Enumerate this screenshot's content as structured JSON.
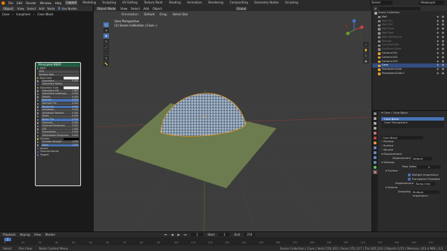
{
  "menu": {
    "items": [
      "File",
      "Edit",
      "Render",
      "Window",
      "Help"
    ],
    "workspaces": [
      "Layout",
      "Modeling",
      "Sculpting",
      "UV Editing",
      "Texture Paint",
      "Shading",
      "Animation",
      "Rendering",
      "Compositing",
      "Geometry Nodes",
      "Scripting"
    ],
    "active_workspace": "Layout",
    "scene": "Scene",
    "view_layer": "ViewLayer"
  },
  "node_editor": {
    "header": {
      "object_btn": "Object",
      "view": "View",
      "select": "Select",
      "add": "Add",
      "node": "Node",
      "use_nodes": "Use Nodes"
    },
    "breadcrumbs": [
      "Cave",
      "Icosphere",
      "Cave Black"
    ],
    "node": {
      "title": "Principled BSDF",
      "rows": [
        {
          "label": "BSDF",
          "value": "",
          "color": "#63c763",
          "kind": "plain"
        },
        {
          "label": "GGX",
          "value": "",
          "color": "",
          "kind": "field"
        },
        {
          "label": "Random Walk",
          "value": "",
          "color": "",
          "kind": "field"
        },
        {
          "label": "Base Color",
          "value": "",
          "color": "#c7c729",
          "kind": "white"
        },
        {
          "label": "Subsurface",
          "value": "0.000",
          "color": "#a1a1a1",
          "kind": "bar"
        },
        {
          "label": "Subsurface Radius",
          "value": "",
          "color": "#6363c7",
          "kind": "field"
        },
        {
          "label": "Subsurface Color",
          "value": "",
          "color": "#c7c729",
          "kind": "white"
        },
        {
          "label": "Subsurface IOR",
          "value": "1.400",
          "color": "#a1a1a1",
          "kind": "bar"
        },
        {
          "label": "Subsurface Anisotropy",
          "value": "0.000",
          "color": "#a1a1a1",
          "kind": "bar"
        },
        {
          "label": "Metallic",
          "value": "0.000",
          "color": "#a1a1a1",
          "kind": "bar"
        },
        {
          "label": "Specular",
          "value": "0.500",
          "color": "#a1a1a1",
          "kind": "blue"
        },
        {
          "label": "Specular Tint",
          "value": "0.000",
          "color": "#a1a1a1",
          "kind": "bar"
        },
        {
          "label": "Roughness",
          "value": "0.500",
          "color": "#a1a1a1",
          "kind": "blue"
        },
        {
          "label": "Anisotropic",
          "value": "0.000",
          "color": "#a1a1a1",
          "kind": "bar"
        },
        {
          "label": "Anisotropic Rotation",
          "value": "0.000",
          "color": "#a1a1a1",
          "kind": "bar"
        },
        {
          "label": "Sheen",
          "value": "0.000",
          "color": "#a1a1a1",
          "kind": "bar"
        },
        {
          "label": "Sheen Tint",
          "value": "0.500",
          "color": "#a1a1a1",
          "kind": "blue"
        },
        {
          "label": "Clearcoat",
          "value": "0.000",
          "color": "#a1a1a1",
          "kind": "bar"
        },
        {
          "label": "Clearcoat Roughness",
          "value": "0.030",
          "color": "#a1a1a1",
          "kind": "bar"
        },
        {
          "label": "IOR",
          "value": "1.450",
          "color": "#a1a1a1",
          "kind": "bar"
        },
        {
          "label": "Transmission",
          "value": "0.000",
          "color": "#a1a1a1",
          "kind": "bar"
        },
        {
          "label": "Transmission Roughness",
          "value": "0.000",
          "color": "#a1a1a1",
          "kind": "bar"
        },
        {
          "label": "Emission",
          "value": "",
          "color": "#c7c729",
          "kind": "black"
        },
        {
          "label": "Emission Strength",
          "value": "1.000",
          "color": "#a1a1a1",
          "kind": "bar"
        },
        {
          "label": "Alpha",
          "value": "1.000",
          "color": "#a1a1a1",
          "kind": "blue"
        },
        {
          "label": "Normal",
          "value": "",
          "color": "#6363c7",
          "kind": "plain"
        },
        {
          "label": "Clearcoat Normal",
          "value": "",
          "color": "#6363c7",
          "kind": "plain"
        },
        {
          "label": "Tangent",
          "value": "",
          "color": "#6363c7",
          "kind": "plain"
        }
      ]
    }
  },
  "viewport": {
    "header": {
      "mode": "Object Mode",
      "view": "View",
      "select": "Select",
      "add": "Add",
      "object": "Object",
      "orientation_label": "Orientation:",
      "orientation": "Default",
      "drag_label": "Drag:",
      "drag": "Select Box",
      "global": "Global"
    },
    "info_line1": "User Perspective",
    "info_line2": "(1) Scene Collection | Cave ◇",
    "tools": [
      "select",
      "cursor",
      "move",
      "rotate",
      "scale",
      "transform",
      "annotate",
      "measure"
    ]
  },
  "outliner": {
    "title": "Scene Collection",
    "items": [
      {
        "name": "Wall",
        "color": "#8a8a8a",
        "dim": false,
        "sel": false
      },
      {
        "name": "Wall.001",
        "color": "#8a8a8a",
        "dim": true,
        "sel": false
      },
      {
        "name": "Wall.002",
        "color": "#8a8a8a",
        "dim": true,
        "sel": false
      },
      {
        "name": "Wall.Floor",
        "color": "#8a8a8a",
        "dim": true,
        "sel": false
      },
      {
        "name": "Wall.Roof",
        "color": "#8a8a8a",
        "dim": true,
        "sel": false
      },
      {
        "name": "Wall.SkyTexture",
        "color": "#8a8a8a",
        "dim": true,
        "sel": false
      },
      {
        "name": "TestLog",
        "color": "#8a8a8a",
        "dim": true,
        "sel": false
      },
      {
        "name": "SunGlare.001",
        "color": "#8a8a8a",
        "dim": true,
        "sel": false
      },
      {
        "name": "SunGlare.Glare",
        "color": "#8a8a8a",
        "dim": true,
        "sel": false
      },
      {
        "name": "Camera.001",
        "color": "#e0a030",
        "dim": false,
        "sel": false
      },
      {
        "name": "Camera.002",
        "color": "#e0a030",
        "dim": false,
        "sel": false
      },
      {
        "name": "Camera.003",
        "color": "#e0a030",
        "dim": false,
        "sel": false
      },
      {
        "name": "Cave",
        "color": "#e0a030",
        "dim": false,
        "sel": true
      },
      {
        "name": "ShadowersGlob",
        "color": "#e0a030",
        "dim": false,
        "sel": false
      },
      {
        "name": "ShadowersGlob.0",
        "color": "#e0a030",
        "dim": false,
        "sel": false
      }
    ]
  },
  "properties": {
    "object_name": "Cave",
    "material_name": "Cave Black",
    "slots": [
      "Cave Black",
      "Cave Transparent"
    ],
    "material_field": "Cave Black",
    "sections": {
      "preview": "Preview",
      "surface": "Surface",
      "volume": "Volume",
      "displacement": "Displacement",
      "displacement_label": "Displacement",
      "displacement_value": "Default",
      "settings": "Settings",
      "pass_index_label": "Pass Index",
      "pass_index_value": "0",
      "surface_sub": "Surface",
      "multiple_importance": "Multiple Importance",
      "transparent_shadows": "Transparent Shadows",
      "disp_label": "Displacement",
      "disp_value": "Bump Only",
      "volume_sub": "Volume",
      "sampling_label": "Sampling",
      "sampling_value": "Multiple Importance"
    }
  },
  "timeline": {
    "playback": "Playback",
    "keying": "Keying",
    "view": "View",
    "marker": "Marker",
    "current_frame": "1",
    "start_label": "Start",
    "start": "1",
    "end_label": "End",
    "end": "250",
    "ruler": [
      "0",
      "10",
      "20",
      "30",
      "40",
      "50",
      "60",
      "70",
      "80",
      "90",
      "100",
      "110",
      "120",
      "130",
      "140",
      "150",
      "160",
      "170",
      "180",
      "190",
      "200",
      "210",
      "220",
      "230",
      "240",
      "250"
    ]
  },
  "status": {
    "select": "Select",
    "pan": "Pan View",
    "context": "Node Context Menu",
    "stats": "Scene Collection | Cave | Verts:150,352 | Faces:151,127 | Tris:302,224 | Objects:1/15 | Memory: 423.4 MiB | 3.0"
  }
}
